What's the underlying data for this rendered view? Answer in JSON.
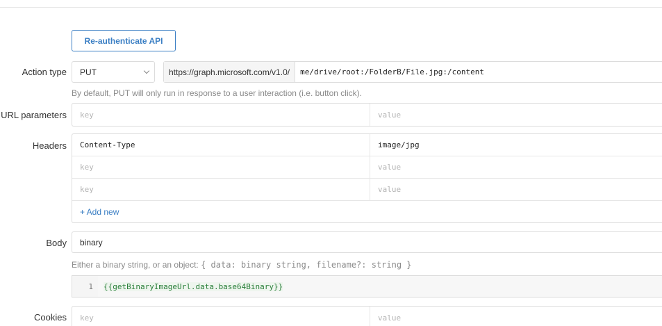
{
  "top": {
    "partial_text": ""
  },
  "reauth_button": "Re-authenticate API",
  "action_type": {
    "label": "Action type",
    "method": "PUT",
    "url_prefix": "https://graph.microsoft.com/v1.0/",
    "url_path": "me/drive/root:/FolderB/File.jpg:/content",
    "hint": "By default, PUT will only run in response to a user interaction (i.e. button click)."
  },
  "url_parameters": {
    "label": "URL parameters",
    "rows": [
      {
        "key_placeholder": "key",
        "value_placeholder": "value"
      }
    ]
  },
  "headers": {
    "label": "Headers",
    "rows": [
      {
        "key": "Content-Type",
        "value": "image/jpg"
      },
      {
        "key_placeholder": "key",
        "value_placeholder": "value"
      },
      {
        "key_placeholder": "key",
        "value_placeholder": "value"
      }
    ],
    "add_new": "+ Add new"
  },
  "body": {
    "label": "Body",
    "type": "binary",
    "hint_prefix": "Either a binary string, or an object: ",
    "hint_code": "{ data: binary string, filename?: string }",
    "code_line_number": "1",
    "code": "{{getBinaryImageUrl.data.base64Binary}}"
  },
  "cookies": {
    "label": "Cookies",
    "rows": [
      {
        "key_placeholder": "key",
        "value_placeholder": "value"
      }
    ]
  },
  "colors": {
    "accent": "#3b7fc4",
    "code_green": "#2e8b3e",
    "border": "#dcdcdc"
  }
}
